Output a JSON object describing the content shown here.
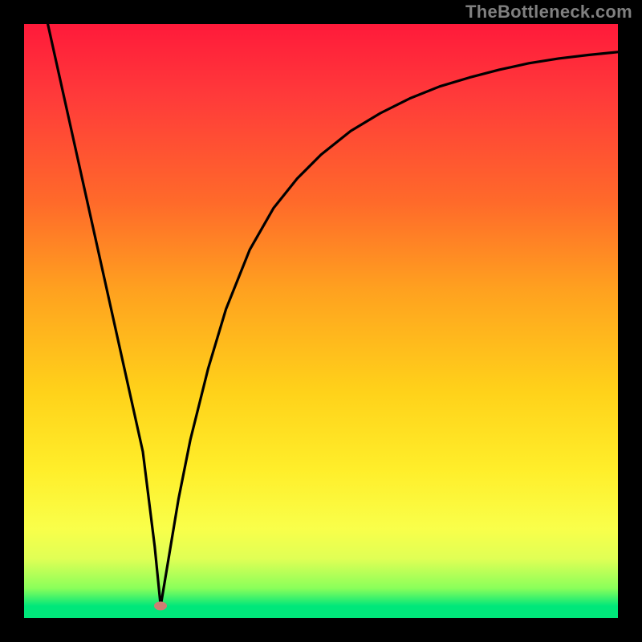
{
  "watermark": "TheBottleneck.com",
  "chart_data": {
    "type": "line",
    "title": "",
    "xlabel": "",
    "ylabel": "",
    "xlim": [
      0,
      100
    ],
    "ylim": [
      0,
      100
    ],
    "grid": false,
    "legend": false,
    "marker": {
      "x": 23,
      "y": 2,
      "color": "#cf7e73"
    },
    "series": [
      {
        "name": "curve",
        "color": "#000000",
        "x": [
          4,
          8,
          12,
          16,
          20,
          22,
          23,
          24,
          26,
          28,
          31,
          34,
          38,
          42,
          46,
          50,
          55,
          60,
          65,
          70,
          75,
          80,
          85,
          90,
          95,
          100
        ],
        "y": [
          100,
          82,
          64,
          46,
          28,
          12,
          2,
          8,
          20,
          30,
          42,
          52,
          62,
          69,
          74,
          78,
          82,
          85,
          87.5,
          89.5,
          91,
          92.3,
          93.4,
          94.2,
          94.8,
          95.3
        ]
      }
    ],
    "background_gradient": {
      "direction": "vertical",
      "stops": [
        {
          "pos": 0.0,
          "color": "#ff1a3a"
        },
        {
          "pos": 0.3,
          "color": "#ff6a2a"
        },
        {
          "pos": 0.62,
          "color": "#ffd21a"
        },
        {
          "pos": 0.85,
          "color": "#f9ff4a"
        },
        {
          "pos": 0.98,
          "color": "#00e77a"
        }
      ]
    }
  }
}
